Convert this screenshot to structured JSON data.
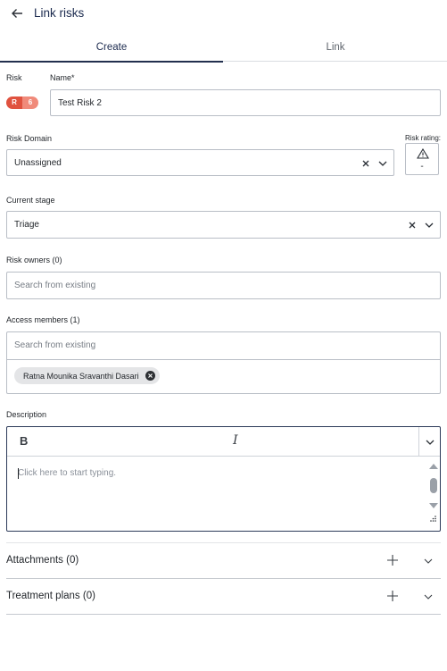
{
  "header": {
    "title": "Link risks",
    "back_icon": "arrow-left-icon"
  },
  "tabs": [
    {
      "label": "Create",
      "active": true
    },
    {
      "label": "Link",
      "active": false
    }
  ],
  "risk": {
    "label": "Risk",
    "badge_letter": "R",
    "badge_number": "6",
    "badge_colors": {
      "letter_bg": "#e0523f",
      "number_bg": "#f08a7a"
    }
  },
  "name": {
    "label": "Name*",
    "value": "Test Risk 2"
  },
  "risk_domain": {
    "label": "Risk Domain",
    "value": "Unassigned"
  },
  "risk_rating": {
    "label": "Risk rating:",
    "value": "-",
    "icon": "warning-triangle-icon"
  },
  "current_stage": {
    "label": "Current stage",
    "value": "Triage"
  },
  "risk_owners": {
    "label": "Risk owners (0)",
    "placeholder": "Search from existing"
  },
  "access_members": {
    "label": "Access members (1)",
    "placeholder": "Search from existing",
    "members": [
      {
        "name": "Ratna Mounika Sravanthi Dasari"
      }
    ]
  },
  "description": {
    "label": "Description",
    "toolbar": {
      "bold": "B",
      "italic": "I"
    },
    "placeholder": "Click here to start typing."
  },
  "sections": [
    {
      "title": "Attachments (0)"
    },
    {
      "title": "Treatment plans (0)"
    }
  ],
  "colors": {
    "accent": "#22304f",
    "border": "#b9bec6",
    "text": "#1f2328"
  }
}
